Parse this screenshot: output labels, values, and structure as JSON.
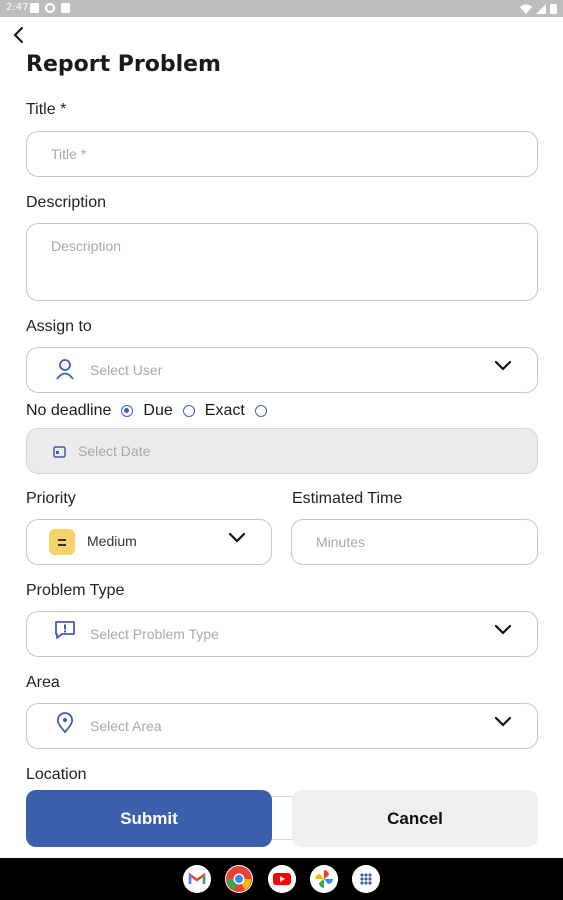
{
  "status_bar": {
    "time": "2:47"
  },
  "header": {
    "title": "Report Problem"
  },
  "form": {
    "title_label": "Title *",
    "title_placeholder": "Title *",
    "description_label": "Description",
    "description_placeholder": "Description",
    "assign_label": "Assign to",
    "assign_placeholder": "Select User",
    "deadline": {
      "options": [
        {
          "label": "No deadline",
          "checked": true
        },
        {
          "label": "Due",
          "checked": false
        },
        {
          "label": "Exact",
          "checked": false
        }
      ]
    },
    "date_placeholder": "Select Date",
    "priority_label": "Priority",
    "priority_value": "Medium",
    "estimated_label": "Estimated Time",
    "estimated_placeholder": "Minutes",
    "problem_type_label": "Problem Type",
    "problem_type_placeholder": "Select Problem Type",
    "area_label": "Area",
    "area_placeholder": "Select Area",
    "location_label": "Location"
  },
  "actions": {
    "submit": "Submit",
    "cancel": "Cancel"
  },
  "colors": {
    "primary": "#3c5fab",
    "priority_medium": "#f7d26b",
    "field_border": "#c7c7c7"
  },
  "nav_apps": [
    "gmail-icon",
    "chrome-icon",
    "youtube-icon",
    "photos-icon",
    "app-drawer-icon"
  ]
}
